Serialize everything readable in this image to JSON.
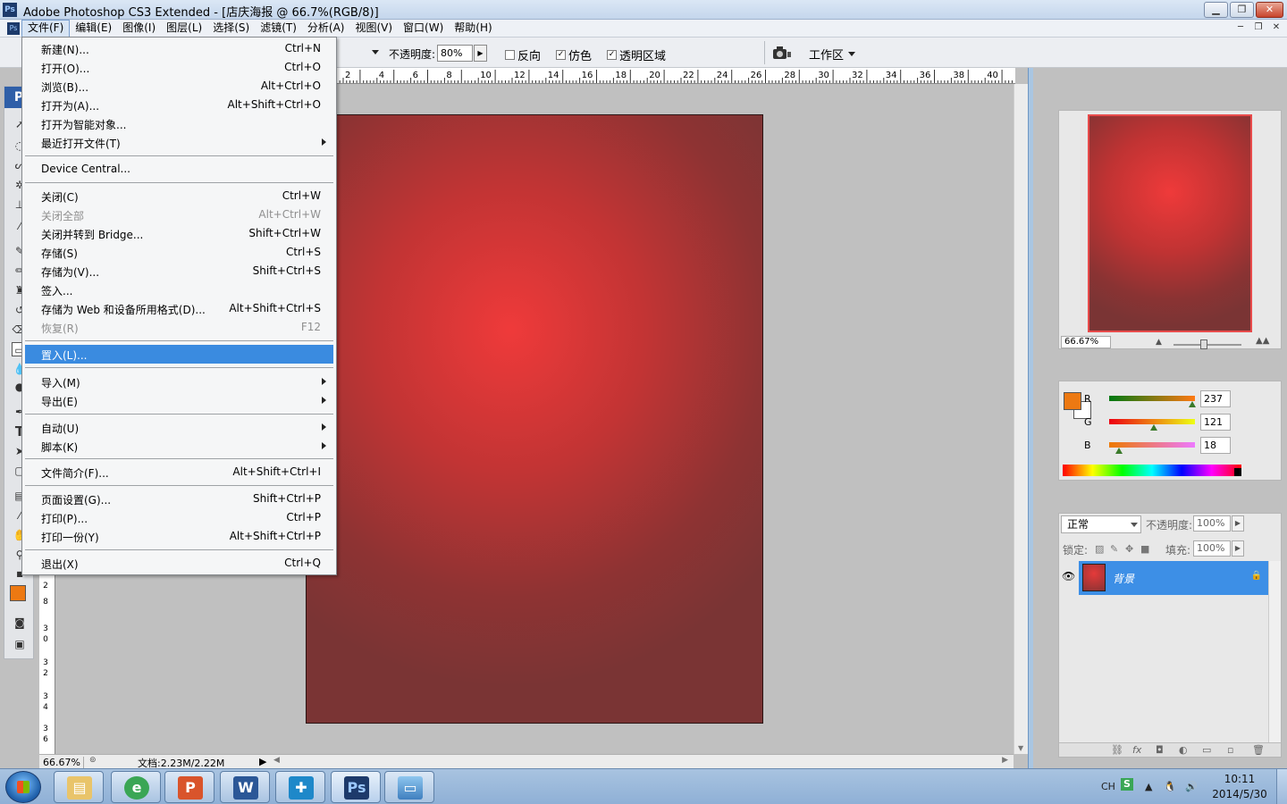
{
  "window": {
    "title": "Adobe Photoshop CS3 Extended - [店庆海报 @ 66.7%(RGB/8)]",
    "controls": [
      "minimize",
      "restore",
      "close"
    ]
  },
  "menubar": {
    "items": [
      "文件(F)",
      "编辑(E)",
      "图像(I)",
      "图层(L)",
      "选择(S)",
      "滤镜(T)",
      "分析(A)",
      "视图(V)",
      "窗口(W)",
      "帮助(H)"
    ],
    "active": "文件(F)"
  },
  "options": {
    "opacity_label": "不透明度:",
    "opacity_value": "80%",
    "reverse_label": "反向",
    "reverse_checked": false,
    "dither_label": "仿色",
    "dither_checked": true,
    "transparency_label": "透明区域",
    "transparency_checked": true,
    "workspace_label": "工作区"
  },
  "file_menu": {
    "items": [
      {
        "label": "新建(N)...",
        "shortcut": "Ctrl+N"
      },
      {
        "label": "打开(O)...",
        "shortcut": "Ctrl+O"
      },
      {
        "label": "浏览(B)...",
        "shortcut": "Alt+Ctrl+O"
      },
      {
        "label": "打开为(A)...",
        "shortcut": "Alt+Shift+Ctrl+O"
      },
      {
        "label": "打开为智能对象...",
        "shortcut": ""
      },
      {
        "label": "最近打开文件(T)",
        "shortcut": "",
        "submenu": true
      },
      {
        "label": "Device Central...",
        "shortcut": ""
      },
      {
        "label": "关闭(C)",
        "shortcut": "Ctrl+W"
      },
      {
        "label": "关闭全部",
        "shortcut": "Alt+Ctrl+W",
        "disabled": true
      },
      {
        "label": "关闭并转到 Bridge...",
        "shortcut": "Shift+Ctrl+W"
      },
      {
        "label": "存储(S)",
        "shortcut": "Ctrl+S"
      },
      {
        "label": "存储为(V)...",
        "shortcut": "Shift+Ctrl+S"
      },
      {
        "label": "签入...",
        "shortcut": ""
      },
      {
        "label": "存储为 Web 和设备所用格式(D)...",
        "shortcut": "Alt+Shift+Ctrl+S"
      },
      {
        "label": "恢复(R)",
        "shortcut": "F12",
        "disabled": true
      },
      {
        "label": "置入(L)...",
        "shortcut": "",
        "highlighted": true
      },
      {
        "label": "导入(M)",
        "shortcut": "",
        "submenu": true
      },
      {
        "label": "导出(E)",
        "shortcut": "",
        "submenu": true
      },
      {
        "label": "自动(U)",
        "shortcut": "",
        "submenu": true
      },
      {
        "label": "脚本(K)",
        "shortcut": "",
        "submenu": true
      },
      {
        "label": "文件简介(F)...",
        "shortcut": "Alt+Shift+Ctrl+I"
      },
      {
        "label": "页面设置(G)...",
        "shortcut": "Shift+Ctrl+P"
      },
      {
        "label": "打印(P)...",
        "shortcut": "Ctrl+P"
      },
      {
        "label": "打印一份(Y)",
        "shortcut": "Alt+Shift+Ctrl+P"
      },
      {
        "label": "退出(X)",
        "shortcut": "Ctrl+Q"
      }
    ]
  },
  "ruler": {
    "top_ticks": [
      "2",
      "4",
      "6",
      "8",
      "10",
      "12",
      "14",
      "16",
      "18",
      "20",
      "22",
      "24",
      "26",
      "28",
      "30",
      "32",
      "34",
      "36",
      "38",
      "40"
    ],
    "left_ticks": [
      "2",
      "8",
      "3",
      "0",
      "3",
      "2",
      "3",
      "4",
      "3",
      "6"
    ]
  },
  "status": {
    "zoom": "66.67%",
    "doc_info": "文档:2.23M/2.22M"
  },
  "navigator": {
    "zoom": "66.67%"
  },
  "color_panel": {
    "foreground_color": "#ed7912",
    "background_color": "#ffffff",
    "channels": [
      {
        "label": "R",
        "value": "237"
      },
      {
        "label": "G",
        "value": "121"
      },
      {
        "label": "B",
        "value": "18"
      }
    ]
  },
  "layers_panel": {
    "blend_mode": "正常",
    "opacity_label": "不透明度:",
    "opacity_value": "100%",
    "lock_label": "锁定:",
    "fill_label": "填充:",
    "fill_value": "100%",
    "layers": [
      {
        "name": "背景",
        "visible": true,
        "locked": true
      }
    ]
  },
  "taskbar": {
    "apps": [
      "explorer",
      "browser",
      "powerpoint",
      "word",
      "store",
      "photoshop",
      "photo-viewer"
    ],
    "photoshop_label": "Ps",
    "tray_lang": "CH",
    "time": "10:11",
    "date": "2014/5/30"
  }
}
